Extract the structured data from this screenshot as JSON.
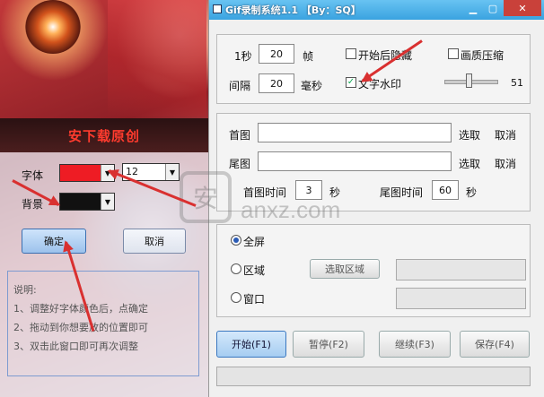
{
  "watermark_tool": {
    "title": "安下载原创",
    "font_label": "字体",
    "font_color": "#ee1c24",
    "font_size": "12",
    "bg_label": "背景",
    "bg_color": "#111111",
    "ok_label": "确定",
    "cancel_label": "取消",
    "tips": {
      "heading": "说明:",
      "lines": [
        "1、调整好字体颜色后，点确定",
        "2、拖动到你想要放的位置即可",
        "3、双击此窗口即可再次调整"
      ]
    }
  },
  "gif_window": {
    "title": "Gif录制系统1.1 【By：SQ】",
    "fps_label": "1秒",
    "fps_value": "20",
    "fps_unit": "帧",
    "interval_label": "间隔",
    "interval_value": "20",
    "interval_unit": "毫秒",
    "hide_after_start": "开始后隐藏",
    "compress": "画质压缩",
    "text_watermark": "文字水印",
    "text_watermark_checked": true,
    "quality_value": "51",
    "quality_fraction": 0.46,
    "first_image_label": "首图",
    "last_image_label": "尾图",
    "select_label": "选取",
    "cancel_label": "取消",
    "first_time_label": "首图时间",
    "first_time_value": "3",
    "last_time_label": "尾图时间",
    "last_time_value": "60",
    "seconds_unit": "秒",
    "fullscreen_label": "全屏",
    "region_label": "区域",
    "select_region_label": "选取区域",
    "window_label": "窗口",
    "start_label": "开始(F1)",
    "pause_label": "暂停(F2)",
    "resume_label": "继续(F3)",
    "save_label": "保存(F4)"
  },
  "site_watermark": {
    "text": "anxz.com",
    "glyph": "安"
  }
}
